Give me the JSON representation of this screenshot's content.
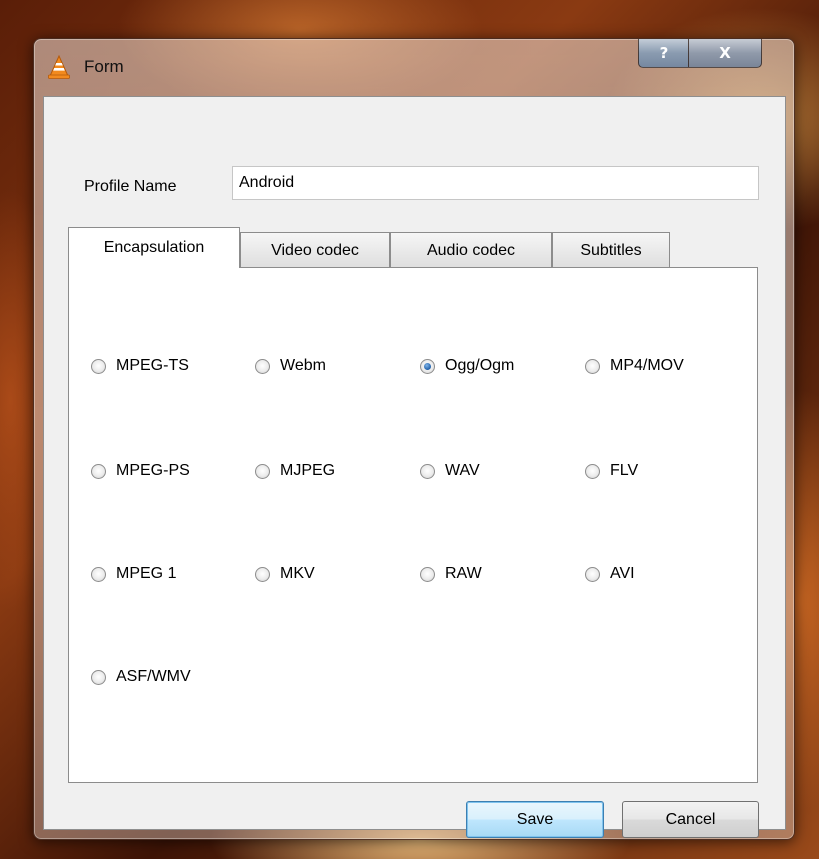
{
  "window": {
    "title": "Form",
    "help_label": "?",
    "close_label": "X"
  },
  "profile": {
    "label": "Profile Name",
    "value": "Android"
  },
  "tabs": [
    {
      "label": "Encapsulation",
      "active": true
    },
    {
      "label": "Video codec",
      "active": false
    },
    {
      "label": "Audio codec",
      "active": false
    },
    {
      "label": "Subtitles",
      "active": false
    }
  ],
  "encapsulation": {
    "selected": "Ogg/Ogm",
    "options": [
      "MPEG-TS",
      "Webm",
      "Ogg/Ogm",
      "MP4/MOV",
      "MPEG-PS",
      "MJPEG",
      "WAV",
      "FLV",
      "MPEG 1",
      "MKV",
      "RAW",
      "AVI",
      "ASF/WMV"
    ]
  },
  "buttons": {
    "save": "Save",
    "cancel": "Cancel"
  },
  "colors": {
    "vlc_orange": "#f28a1e",
    "default_button": "#3c7fb1"
  }
}
